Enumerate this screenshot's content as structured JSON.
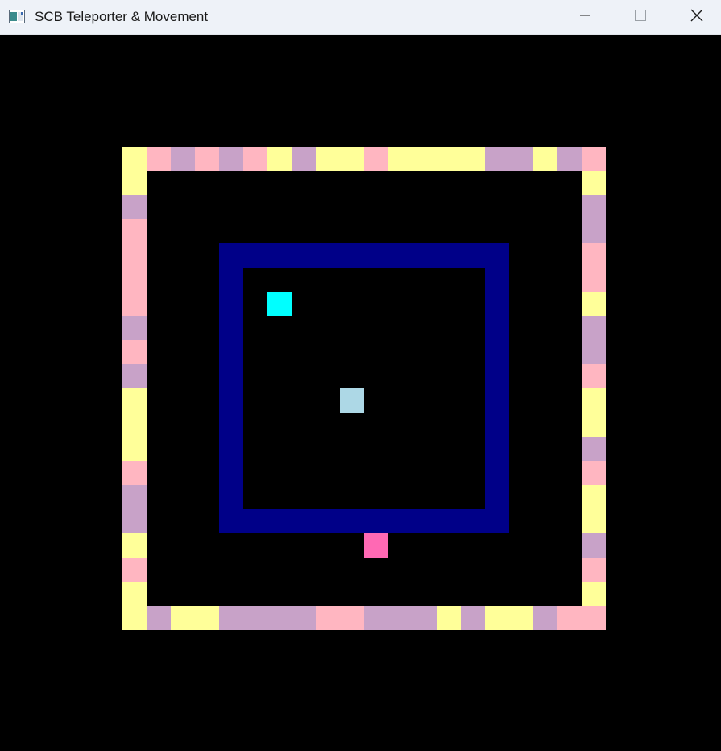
{
  "window": {
    "title": "SCB Teleporter & Movement",
    "controls": {
      "minimize_icon": "minimize-icon",
      "maximize_icon": "maximize-icon",
      "close_icon": "close-icon"
    }
  },
  "palette": {
    "background": "#000000",
    "yellow": "#ffff99",
    "pink": "#ffb6c1",
    "lavender": "#c8a2c8",
    "navy": "#000088",
    "cyan": "#00ffff",
    "light_blue": "#add8e6",
    "hot_pink": "#ff69b4"
  },
  "game": {
    "grid_cols": 20,
    "grid_rows": 20,
    "outer_border": {
      "top": [
        "Y",
        "P",
        "L",
        "P",
        "L",
        "P",
        "Y",
        "L",
        "Y",
        "Y",
        "P",
        "Y",
        "Y",
        "Y",
        "Y",
        "L",
        "L",
        "Y",
        "L",
        "P"
      ],
      "right": [
        "Y",
        "L",
        "L",
        "P",
        "P",
        "Y",
        "L",
        "L",
        "P",
        "Y",
        "Y",
        "L",
        "P",
        "Y",
        "Y",
        "L",
        "P",
        "Y"
      ],
      "bottom": [
        "Y",
        "L",
        "Y",
        "Y",
        "L",
        "L",
        "L",
        "L",
        "P",
        "P",
        "L",
        "L",
        "L",
        "Y",
        "L",
        "Y",
        "Y",
        "L",
        "P",
        "P"
      ],
      "left": [
        "Y",
        "L",
        "P",
        "P",
        "P",
        "P",
        "L",
        "P",
        "L",
        "Y",
        "Y",
        "Y",
        "P",
        "L",
        "L",
        "Y",
        "P",
        "Y"
      ]
    },
    "inner_wall": {
      "color": "navy"
    },
    "entities": [
      {
        "name": "teleporter",
        "color": "cyan"
      },
      {
        "name": "player",
        "color": "light_blue"
      },
      {
        "name": "goal",
        "color": "hot_pink"
      }
    ]
  }
}
